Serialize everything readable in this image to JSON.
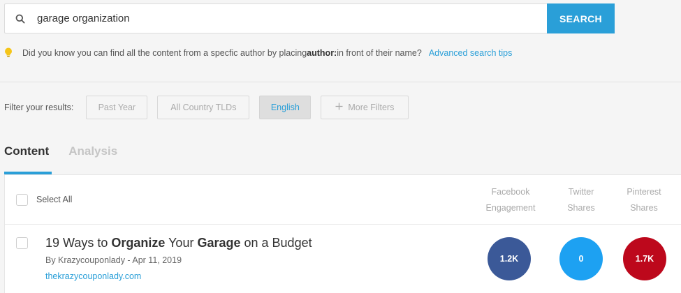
{
  "search": {
    "query": "garage organization",
    "button_label": "SEARCH"
  },
  "tip": {
    "text_before": "Did you know you can find all the content from a specfic author by placing ",
    "keyword": "author:",
    "text_after": " in front of their name?",
    "link_label": "Advanced search tips"
  },
  "filters": {
    "label": "Filter your results:",
    "chips": [
      "Past Year",
      "All Country TLDs",
      "English",
      "More Filters"
    ],
    "active_chip": "English"
  },
  "tabs": [
    {
      "label": "Content",
      "active": true
    },
    {
      "label": "Analysis",
      "active": false
    }
  ],
  "table": {
    "select_all_label": "Select All",
    "columns": [
      {
        "line1": "Facebook",
        "line2": "Engagement"
      },
      {
        "line1": "Twitter",
        "line2": "Shares"
      },
      {
        "line1": "Pinterest",
        "line2": "Shares"
      }
    ],
    "rows": [
      {
        "title_parts": [
          {
            "text": "19 Ways to ",
            "bold": false
          },
          {
            "text": "Organize",
            "bold": true
          },
          {
            "text": " Your ",
            "bold": false
          },
          {
            "text": "Garage",
            "bold": true
          },
          {
            "text": " on a Budget",
            "bold": false
          }
        ],
        "byline": "By Krazycouponlady - Apr 11, 2019",
        "url": "thekrazycouponlady.com",
        "facebook_engagement": "1.2K",
        "twitter_shares": "0",
        "pinterest_shares": "1.7K"
      }
    ]
  },
  "colors": {
    "accent": "#2a9fd8",
    "facebook": "#3b5998",
    "twitter": "#1da1f2",
    "pinterest": "#bd081c",
    "tip_icon": "#f5c518"
  },
  "icons": [
    "search-icon",
    "lightbulb-icon",
    "plus-icon"
  ]
}
